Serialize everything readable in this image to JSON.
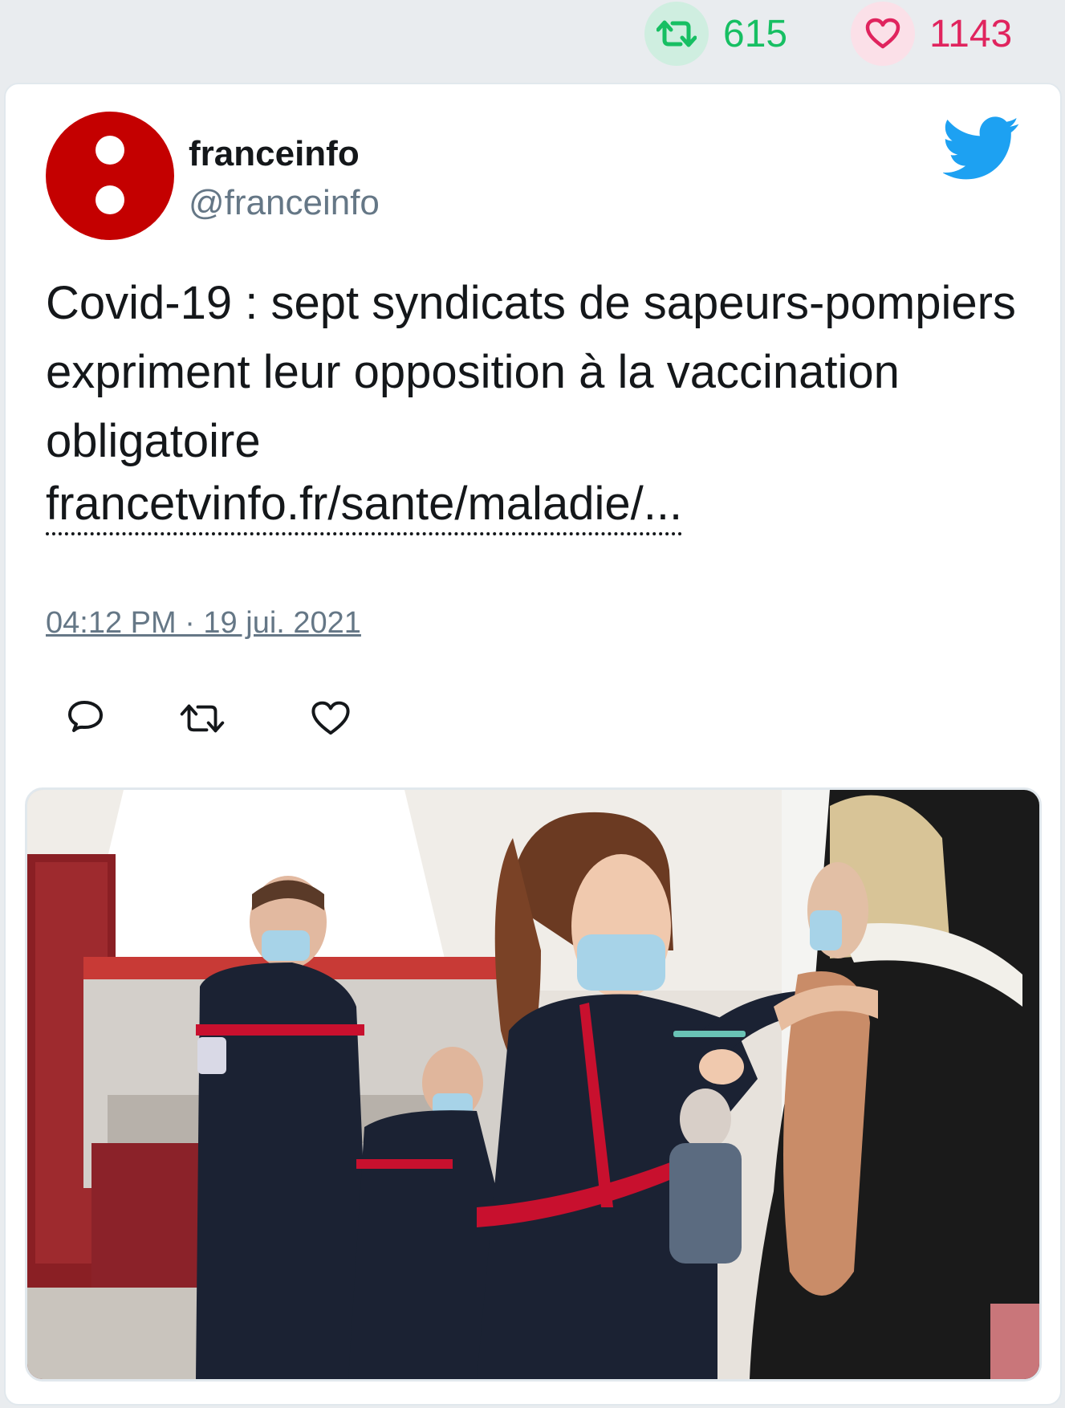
{
  "stats": {
    "retweets": "615",
    "likes": "1143",
    "retweet_color": "#17bf63",
    "like_color": "#e0245e"
  },
  "tweet": {
    "author_name": "franceinfo",
    "author_handle": "@franceinfo",
    "text": "Covid-19 : sept syndicats de sapeurs-pompiers expriment leur opposition à la vaccination obligatoire",
    "link": "francetvinfo.fr/sante/maladie/...",
    "timestamp": "04:12 PM · 19 jui. 2021",
    "avatar_color": "#c40000",
    "brand_icon": "twitter-bird-icon"
  },
  "actions": {
    "icons": [
      "reply-icon",
      "retweet-icon",
      "like-icon"
    ]
  },
  "media": {
    "icon": "photo-image",
    "colors": {
      "uniform": "#1b2233",
      "stripe": "#c8102e"
    }
  }
}
